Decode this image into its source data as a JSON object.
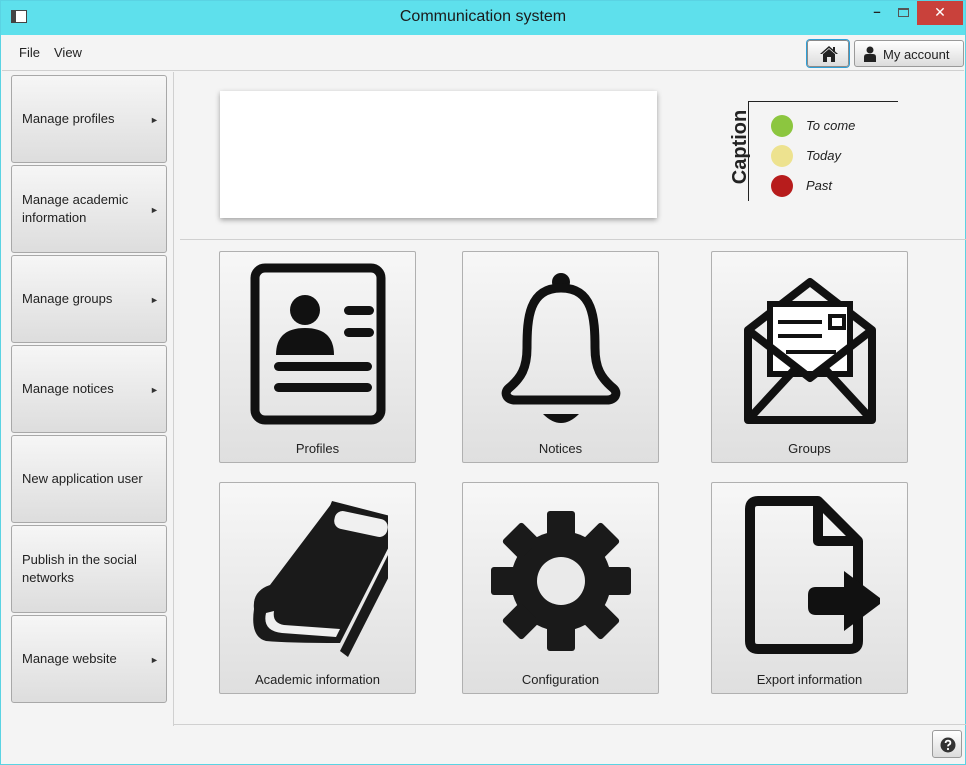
{
  "window": {
    "title": "Communication system",
    "minimize_glyph": "–",
    "close_glyph": "✕"
  },
  "menu": {
    "file": "File",
    "view": "View"
  },
  "toolbar": {
    "home_icon": "home-icon",
    "account_label": "My account",
    "account_icon": "user-icon"
  },
  "sidebar": {
    "items": [
      {
        "label": "Manage profiles",
        "submenu": true
      },
      {
        "label": "Manage academic information",
        "submenu": true
      },
      {
        "label": "Manage groups",
        "submenu": true
      },
      {
        "label": "Manage notices",
        "submenu": true
      },
      {
        "label": "New application user",
        "submenu": false
      },
      {
        "label": "Publish in the social networks",
        "submenu": false
      },
      {
        "label": "Manage website",
        "submenu": true
      }
    ],
    "arrow": "►"
  },
  "caption": {
    "title": "Caption",
    "items": [
      {
        "label": "To come",
        "color": "#8cc63f"
      },
      {
        "label": "Today",
        "color": "#ede28f"
      },
      {
        "label": "Past",
        "color": "#b71c1c"
      }
    ]
  },
  "tiles": [
    {
      "label": "Profiles",
      "icon": "profile-card-icon"
    },
    {
      "label": "Notices",
      "icon": "bell-icon"
    },
    {
      "label": "Groups",
      "icon": "envelope-icon"
    },
    {
      "label": "Academic information",
      "icon": "book-icon"
    },
    {
      "label": "Configuration",
      "icon": "gear-icon"
    },
    {
      "label": "Export information",
      "icon": "export-file-icon"
    }
  ],
  "footer": {
    "help_icon": "help-icon"
  },
  "colors": {
    "titlebar": "#5ee0ec",
    "close": "#c9413b",
    "focus": "#2f9fd6"
  }
}
